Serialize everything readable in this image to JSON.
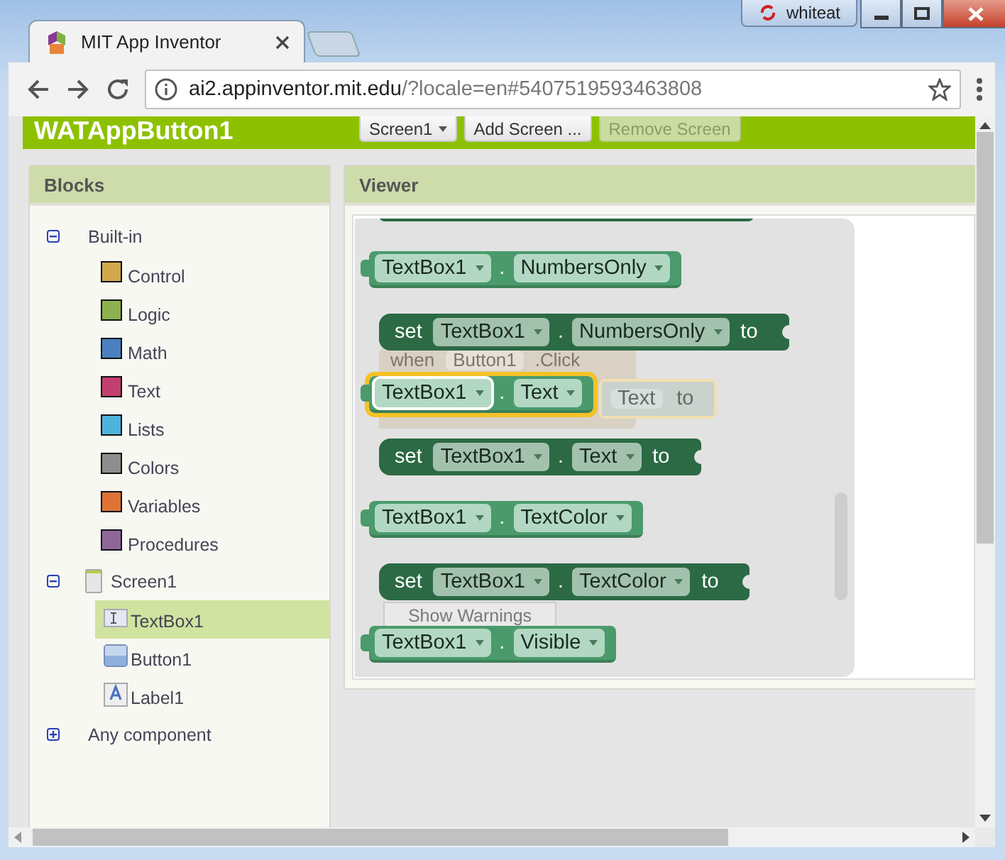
{
  "browser": {
    "tab_title": "MIT App Inventor",
    "user_badge": "whiteat",
    "url_host": "ai2.appinventor.mit.edu",
    "url_path": "/?locale=en#5407519593463808"
  },
  "app": {
    "project_name": "WATAppButton1",
    "screen_button": "Screen1",
    "buttons": [
      {
        "label": "Add Screen ...",
        "disabled": false
      },
      {
        "label": "Remove Screen",
        "disabled": true
      }
    ]
  },
  "blocks_panel": {
    "title": "Blocks",
    "tree": [
      {
        "label": "Built-in",
        "kind": "group",
        "expanded": true,
        "children": [
          {
            "label": "Control",
            "kind": "category",
            "color": "#d1a84a"
          },
          {
            "label": "Logic",
            "kind": "category",
            "color": "#8bb24e"
          },
          {
            "label": "Math",
            "kind": "category",
            "color": "#4a80bf"
          },
          {
            "label": "Text",
            "kind": "category",
            "color": "#c23f6e"
          },
          {
            "label": "Lists",
            "kind": "category",
            "color": "#4eb3dc"
          },
          {
            "label": "Colors",
            "kind": "category",
            "color": "#8e8e8e"
          },
          {
            "label": "Variables",
            "kind": "category",
            "color": "#de7338"
          },
          {
            "label": "Procedures",
            "kind": "category",
            "color": "#8e6796"
          }
        ]
      },
      {
        "label": "Screen1",
        "kind": "screen",
        "expanded": true,
        "children": [
          {
            "label": "TextBox1",
            "kind": "textbox",
            "selected": true
          },
          {
            "label": "Button1",
            "kind": "button",
            "selected": false
          },
          {
            "label": "Label1",
            "kind": "label",
            "selected": false
          }
        ]
      },
      {
        "label": "Any component",
        "kind": "group",
        "expanded": false
      }
    ]
  },
  "viewer": {
    "title": "Viewer",
    "ghost": {
      "event_word": "when",
      "component": "Button1",
      "event": ".Click",
      "property": "Text",
      "suffix": "to"
    },
    "show_warnings": "Show Warnings",
    "blocks": [
      {
        "kind": "getter",
        "component": "TextBox1",
        "dot": ".",
        "property": "NumbersOnly",
        "highlighted": false
      },
      {
        "kind": "setter",
        "prefix": "set",
        "component": "TextBox1",
        "dot": ".",
        "property": "NumbersOnly",
        "suffix": "to",
        "highlighted": false
      },
      {
        "kind": "getter",
        "component": "TextBox1",
        "dot": ".",
        "property": "Text",
        "highlighted": true
      },
      {
        "kind": "setter",
        "prefix": "set",
        "component": "TextBox1",
        "dot": ".",
        "property": "Text",
        "suffix": "to",
        "highlighted": false
      },
      {
        "kind": "getter",
        "component": "TextBox1",
        "dot": ".",
        "property": "TextColor",
        "highlighted": false
      },
      {
        "kind": "setter",
        "prefix": "set",
        "component": "TextBox1",
        "dot": ".",
        "property": "TextColor",
        "suffix": "to",
        "highlighted": false
      },
      {
        "kind": "getter",
        "component": "TextBox1",
        "dot": ".",
        "property": "Visible",
        "highlighted": false
      }
    ]
  }
}
